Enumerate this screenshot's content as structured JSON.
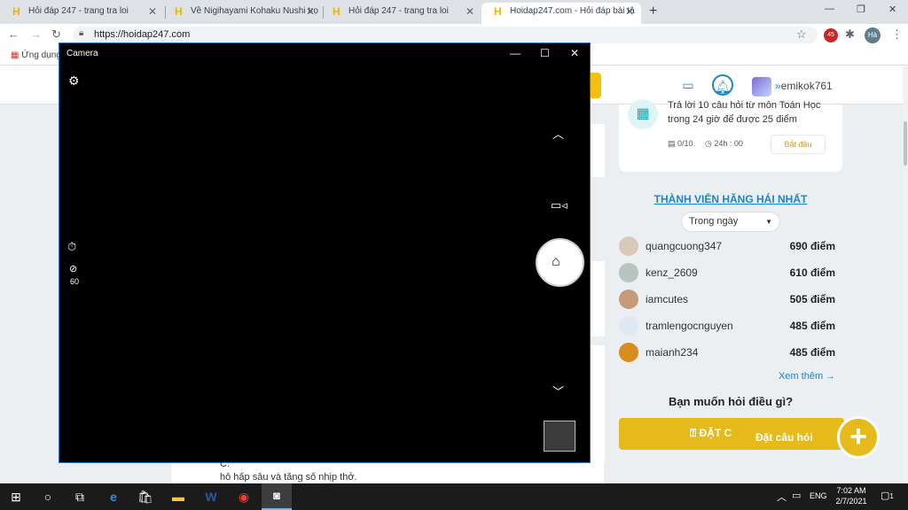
{
  "browser": {
    "tabs": [
      {
        "title": "Hỏi đáp 247 - trang tra loi",
        "active": false
      },
      {
        "title": "Về Nigihayami Kohaku Nushi trọ",
        "active": false
      },
      {
        "title": "Hỏi đáp 247 - trang tra loi",
        "active": false
      },
      {
        "title": "Hoidap247.com - Hỏi đáp bài tậ",
        "active": true
      }
    ],
    "new_tab": "+",
    "url": "https://hoidap247.com",
    "bookmarks_label": "Ứng dụng",
    "profile_initials": "Hà",
    "extension_badge": "45"
  },
  "site": {
    "username": "emikok761",
    "challenge": {
      "text": "Trả lời 10 câu hỏi từ môn Toán Học trong 24 giờ để được 25 điểm",
      "progress": "0/10",
      "time": "24h : 00",
      "start_label": "Bắt đầu"
    },
    "members_title": "THÀNH VIÊN HĂNG HÁI NHẤT",
    "period": "Trong ngày",
    "members": [
      {
        "name": "quangcuong347",
        "points": "690 điểm",
        "color": "#d9c9b8"
      },
      {
        "name": "kenz_2609",
        "points": "610 điểm",
        "color": "#b8c4bf"
      },
      {
        "name": "iamcutes",
        "points": "505 điểm",
        "color": "#c49a7a"
      },
      {
        "name": "tramlengocnguyen",
        "points": "485 điểm",
        "color": "#dfe9f5"
      },
      {
        "name": "maianh234",
        "points": "485 điểm",
        "color": "#d98b1e"
      }
    ],
    "see_more": "Xem thêm →",
    "ask_title": "Bạn muốn hỏi điều gì?",
    "ask_button": "ĐẶT C",
    "ask_tooltip": "Đặt câu hỏi",
    "answer_letter": "C.",
    "answer_text": "hô hấp sâu và tăng số nhịp thở."
  },
  "camera": {
    "title": "Camera",
    "fps": "60"
  },
  "taskbar": {
    "time": "7:02 AM",
    "date": "2/7/2021",
    "language": "ENG",
    "notifications": "1"
  }
}
